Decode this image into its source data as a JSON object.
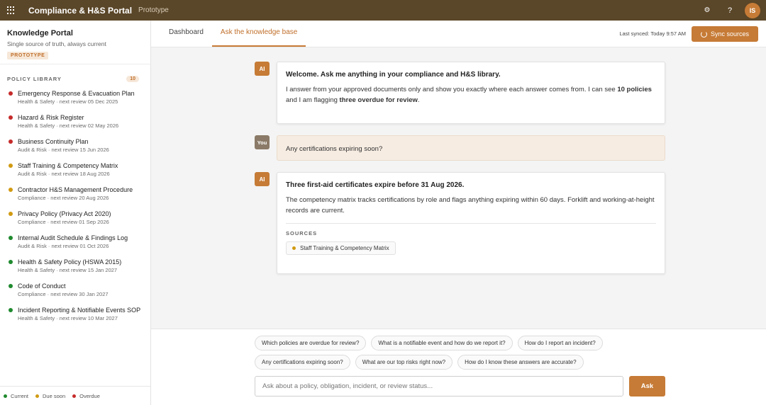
{
  "topbar": {
    "title": "Compliance & H&S Portal",
    "subtitle": "Prototype",
    "help_label": "?",
    "avatar_initials": "IS"
  },
  "sidebar": {
    "title": "Knowledge Portal",
    "subtitle": "Single source of truth, always current",
    "badge": "PROTOTYPE",
    "library_title": "POLICY LIBRARY",
    "library_count": "10",
    "policies": [
      {
        "name": "Emergency Response & Evacuation Plan",
        "meta": "Health & Safety · next review 05 Dec 2025",
        "status": "overdue"
      },
      {
        "name": "Hazard & Risk Register",
        "meta": "Health & Safety · next review 02 May 2026",
        "status": "overdue"
      },
      {
        "name": "Business Continuity Plan",
        "meta": "Audit & Risk · next review 15 Jun 2026",
        "status": "overdue"
      },
      {
        "name": "Staff Training & Competency Matrix",
        "meta": "Audit & Risk · next review 18 Aug 2026",
        "status": "due"
      },
      {
        "name": "Contractor H&S Management Procedure",
        "meta": "Compliance · next review 20 Aug 2026",
        "status": "due"
      },
      {
        "name": "Privacy Policy (Privacy Act 2020)",
        "meta": "Compliance · next review 01 Sep 2026",
        "status": "due"
      },
      {
        "name": "Internal Audit Schedule & Findings Log",
        "meta": "Audit & Risk · next review 01 Oct 2026",
        "status": "current"
      },
      {
        "name": "Health & Safety Policy (HSWA 2015)",
        "meta": "Health & Safety · next review 15 Jan 2027",
        "status": "current"
      },
      {
        "name": "Code of Conduct",
        "meta": "Compliance · next review 30 Jan 2027",
        "status": "current"
      },
      {
        "name": "Incident Reporting & Notifiable Events SOP",
        "meta": "Health & Safety · next review 10 Mar 2027",
        "status": "current"
      }
    ],
    "legend": [
      {
        "label": "Current",
        "status": "current"
      },
      {
        "label": "Due soon",
        "status": "due"
      },
      {
        "label": "Overdue",
        "status": "overdue"
      }
    ]
  },
  "colors": {
    "current": "#1f8a2e",
    "due": "#d19a12",
    "overdue": "#c62b2b",
    "accent": "#c67b36",
    "topbar": "#5a4628"
  },
  "tabs": [
    {
      "label": "Dashboard",
      "active": false
    },
    {
      "label": "Ask the knowledge base",
      "active": true
    }
  ],
  "sync": {
    "status": "Last synced: Today 9:57 AM",
    "button_label": "Sync sources"
  },
  "chat": {
    "messages": [
      {
        "role_tag": "AI",
        "heading": "Welcome. Ask me anything in your compliance and H&S library.",
        "body_pre": "I answer from your approved documents only and show you exactly where each answer comes from. I can see ",
        "body_bold1": "10 policies",
        "body_mid": " and I am flagging ",
        "body_bold2": "three overdue for review",
        "body_post": "."
      },
      {
        "role_tag": "You",
        "text": "Any certifications expiring soon?"
      },
      {
        "role_tag": "AI",
        "heading": "Three first-aid certificates expire before 31 Aug 2026.",
        "body": "The competency matrix tracks certifications by role and flags anything expiring within 60 days. Forklift and working-at-height records are current.",
        "sources_label": "SOURCES",
        "source": "Staff Training & Competency Matrix"
      }
    ]
  },
  "suggestions": {
    "row1": [
      "Which policies are overdue for review?",
      "What is a notifiable event and how do we report it?",
      "How do I report an incident?"
    ],
    "row2": [
      "Any certifications expiring soon?",
      "What are our top risks right now?",
      "How do I know these answers are accurate?"
    ]
  },
  "composer": {
    "placeholder": "Ask about a policy, obligation, incident, or review status...",
    "value": "",
    "ask_label": "Ask"
  }
}
